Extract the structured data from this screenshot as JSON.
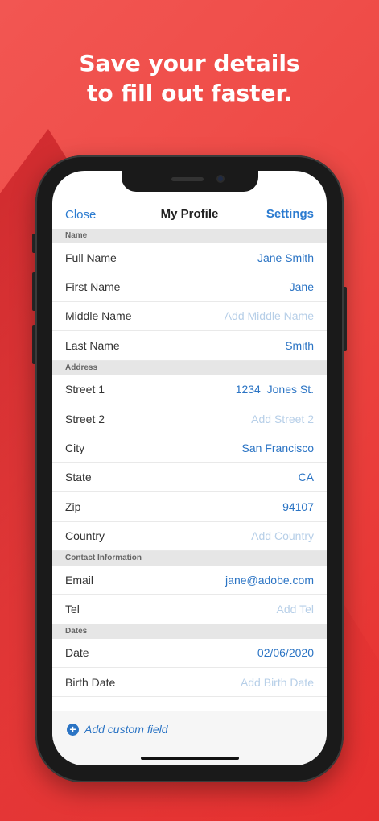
{
  "headline": {
    "line1": "Save your details",
    "line2": "to fill out faster."
  },
  "navbar": {
    "close": "Close",
    "title": "My Profile",
    "settings": "Settings"
  },
  "sections": {
    "name": {
      "title": "Name",
      "rows": [
        {
          "label": "Full Name",
          "value": "Jane Smith"
        },
        {
          "label": "First Name",
          "value": "Jane"
        },
        {
          "label": "Middle Name",
          "placeholder": "Add Middle Name"
        },
        {
          "label": "Last Name",
          "value": "Smith"
        }
      ]
    },
    "address": {
      "title": "Address",
      "rows": [
        {
          "label": "Street 1",
          "value": "1234  Jones St."
        },
        {
          "label": "Street 2",
          "placeholder": "Add Street 2"
        },
        {
          "label": "City",
          "value": "San Francisco"
        },
        {
          "label": "State",
          "value": "CA"
        },
        {
          "label": "Zip",
          "value": "94107"
        },
        {
          "label": "Country",
          "placeholder": "Add Country"
        }
      ]
    },
    "contact": {
      "title": "Contact Information",
      "rows": [
        {
          "label": "Email",
          "value": "jane@adobe.com"
        },
        {
          "label": "Tel",
          "placeholder": "Add Tel"
        }
      ]
    },
    "dates": {
      "title": "Dates",
      "rows": [
        {
          "label": "Date",
          "value": "02/06/2020"
        },
        {
          "label": "Birth Date",
          "placeholder": "Add Birth Date"
        }
      ]
    }
  },
  "footer": {
    "add_custom_field": "Add custom field"
  },
  "colors": {
    "background": "#ee4a46",
    "accent": "#2b74c4",
    "placeholder": "#b7cfe8"
  }
}
